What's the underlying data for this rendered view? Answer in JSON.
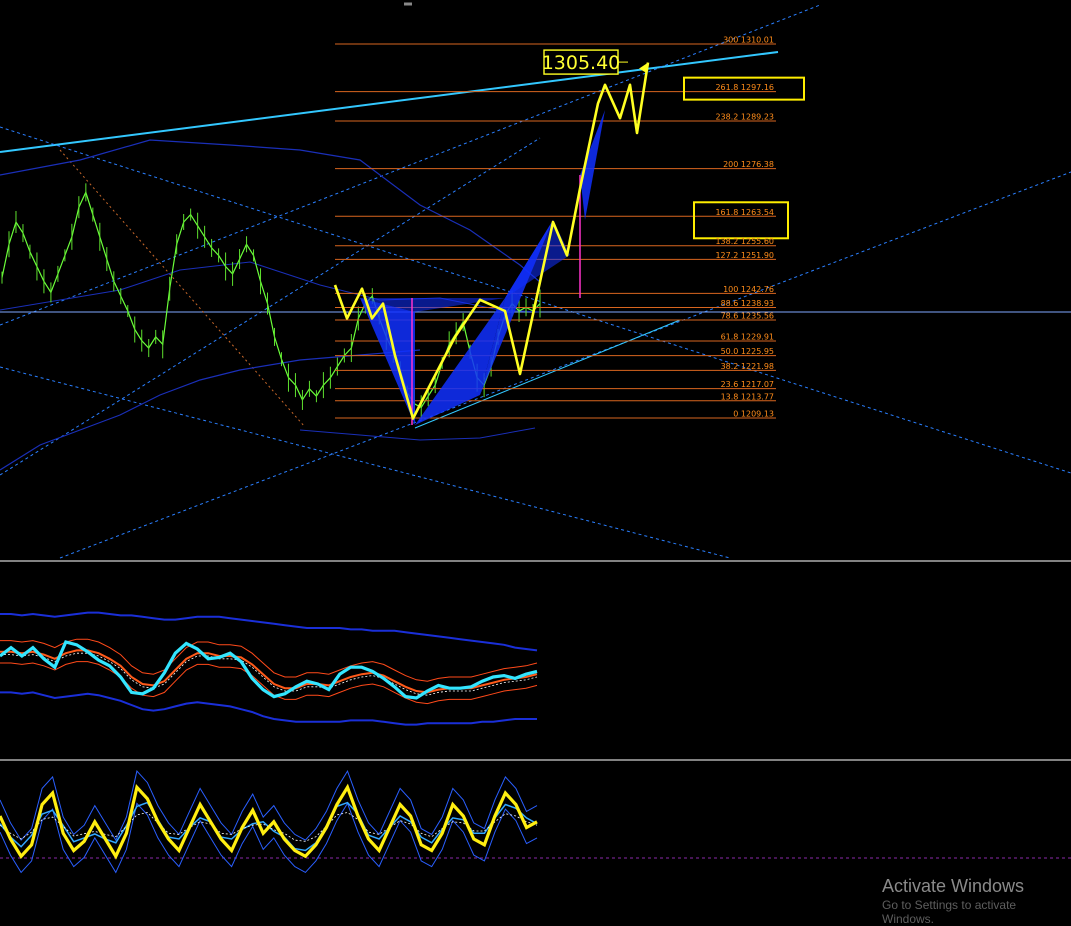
{
  "chart_data": {
    "type": "line",
    "title": "",
    "main_price": {
      "close_path": [
        1247,
        1256,
        1262,
        1259,
        1254,
        1250,
        1246,
        1243,
        1248,
        1253,
        1258,
        1266,
        1270,
        1264,
        1258,
        1252,
        1246,
        1242,
        1238,
        1233,
        1230,
        1228,
        1231,
        1229,
        1244,
        1256,
        1262,
        1264,
        1261,
        1258,
        1255,
        1253,
        1250,
        1248,
        1252,
        1256,
        1253,
        1246,
        1240,
        1231,
        1225,
        1220,
        1218,
        1214,
        1217,
        1215,
        1218,
        1220,
        1223,
        1226,
        1228,
        1236,
        1240,
        1242,
        1236,
        1231,
        1227,
        1222,
        1216,
        1213,
        1212,
        1215,
        1218,
        1224,
        1229,
        1232,
        1235,
        1227,
        1220,
        1218,
        1223,
        1231,
        1237,
        1240,
        1238,
        1239,
        1238,
        1240
      ],
      "fib_retracement": [
        {
          "level": "300",
          "price": 1310.01,
          "label": "300 1310.01"
        },
        {
          "level": "261.8",
          "price": 1297.16,
          "label": "261.8 1297.16"
        },
        {
          "level": "238.2",
          "price": 1289.23,
          "label": "238.2 1289.23"
        },
        {
          "level": "200",
          "price": 1276.38,
          "label": "200 1276.38"
        },
        {
          "level": "161.8",
          "price": 1263.54,
          "label": "161.8 1263.54"
        },
        {
          "level": "138.2",
          "price": 1255.6,
          "label": "138.2 1255.60"
        },
        {
          "level": "127.2",
          "price": 1251.9,
          "label": "127.2 1251.90"
        },
        {
          "level": "100",
          "price": 1242.76,
          "label": "100 1242.76"
        },
        {
          "level": "88.6",
          "price": 1238.93,
          "label": "88.6 1238.93"
        },
        {
          "level": "78.6",
          "price": 1235.56,
          "label": "78.6 1235.56"
        },
        {
          "level": "61.8",
          "price": 1229.91,
          "label": "61.8 1229.91"
        },
        {
          "level": "50.0",
          "price": 1225.95,
          "label": "50.0 1225.95"
        },
        {
          "level": "38.2",
          "price": 1221.98,
          "label": "38.2 1221.98"
        },
        {
          "level": "23.6",
          "price": 1217.07,
          "label": "23.6 1217.07"
        },
        {
          "level": "13.8",
          "price": 1213.77,
          "label": "13.8 1213.77"
        },
        {
          "level": "0",
          "price": 1209.13,
          "label": "0 1209.13"
        }
      ],
      "highlighted_levels": [
        "261.8",
        "161.8"
      ],
      "target_price": "1305.40",
      "projection_path": [
        1245,
        1236,
        1244,
        1236,
        1240,
        1226,
        1209,
        1218,
        1231,
        1241,
        1238,
        1221,
        1262,
        1253,
        1271,
        1294,
        1299,
        1290,
        1299,
        1286,
        1305
      ]
    },
    "oscillator_1": {
      "main": [
        60,
        66,
        60,
        66,
        58,
        52,
        70,
        68,
        63,
        57,
        53,
        45,
        34,
        33,
        37,
        48,
        62,
        69,
        65,
        58,
        59,
        62,
        56,
        44,
        36,
        31,
        33,
        38,
        42,
        40,
        36,
        47,
        52,
        52,
        49,
        44,
        38,
        31,
        30,
        35,
        39,
        37,
        37,
        38,
        42,
        45,
        46,
        44,
        47,
        49
      ],
      "signal": [
        63,
        63,
        62,
        63,
        61,
        58,
        62,
        64,
        64,
        62,
        58,
        53,
        45,
        40,
        39,
        42,
        50,
        58,
        62,
        62,
        60,
        60,
        59,
        54,
        47,
        40,
        37,
        37,
        40,
        40,
        39,
        42,
        45,
        47,
        48,
        46,
        42,
        38,
        35,
        34,
        36,
        37,
        37,
        37,
        39,
        41,
        43,
        44,
        45,
        47
      ],
      "band_upper": [
        90,
        90,
        89,
        90,
        89,
        88,
        89,
        90,
        91,
        91,
        90,
        89,
        89,
        88,
        87,
        86,
        86,
        87,
        88,
        88,
        88,
        87,
        86,
        85,
        84,
        83,
        82,
        81,
        80,
        80,
        80,
        80,
        79,
        79,
        78,
        78,
        78,
        77,
        76,
        75,
        74,
        73,
        72,
        71,
        70,
        69,
        68,
        66,
        65,
        64
      ],
      "band_lower": [
        34,
        34,
        33,
        34,
        32,
        30,
        31,
        32,
        33,
        32,
        30,
        28,
        25,
        22,
        21,
        22,
        24,
        26,
        27,
        26,
        25,
        24,
        22,
        20,
        17,
        15,
        14,
        13,
        13,
        13,
        13,
        13,
        14,
        14,
        14,
        13,
        12,
        11,
        11,
        12,
        12,
        12,
        12,
        12,
        13,
        13,
        14,
        15,
        15,
        15
      ]
    },
    "oscillator_2": {
      "main": [
        60,
        40,
        25,
        35,
        70,
        80,
        45,
        30,
        38,
        55,
        40,
        25,
        45,
        85,
        75,
        55,
        40,
        30,
        50,
        70,
        55,
        40,
        30,
        50,
        65,
        45,
        55,
        40,
        30,
        25,
        35,
        50,
        70,
        85,
        60,
        40,
        30,
        50,
        70,
        60,
        35,
        30,
        45,
        70,
        60,
        40,
        35,
        60,
        80,
        70,
        50,
        55
      ]
    }
  },
  "os_watermark": {
    "title": "Activate Windows",
    "subtitle": "Go to Settings to activate Windows."
  }
}
